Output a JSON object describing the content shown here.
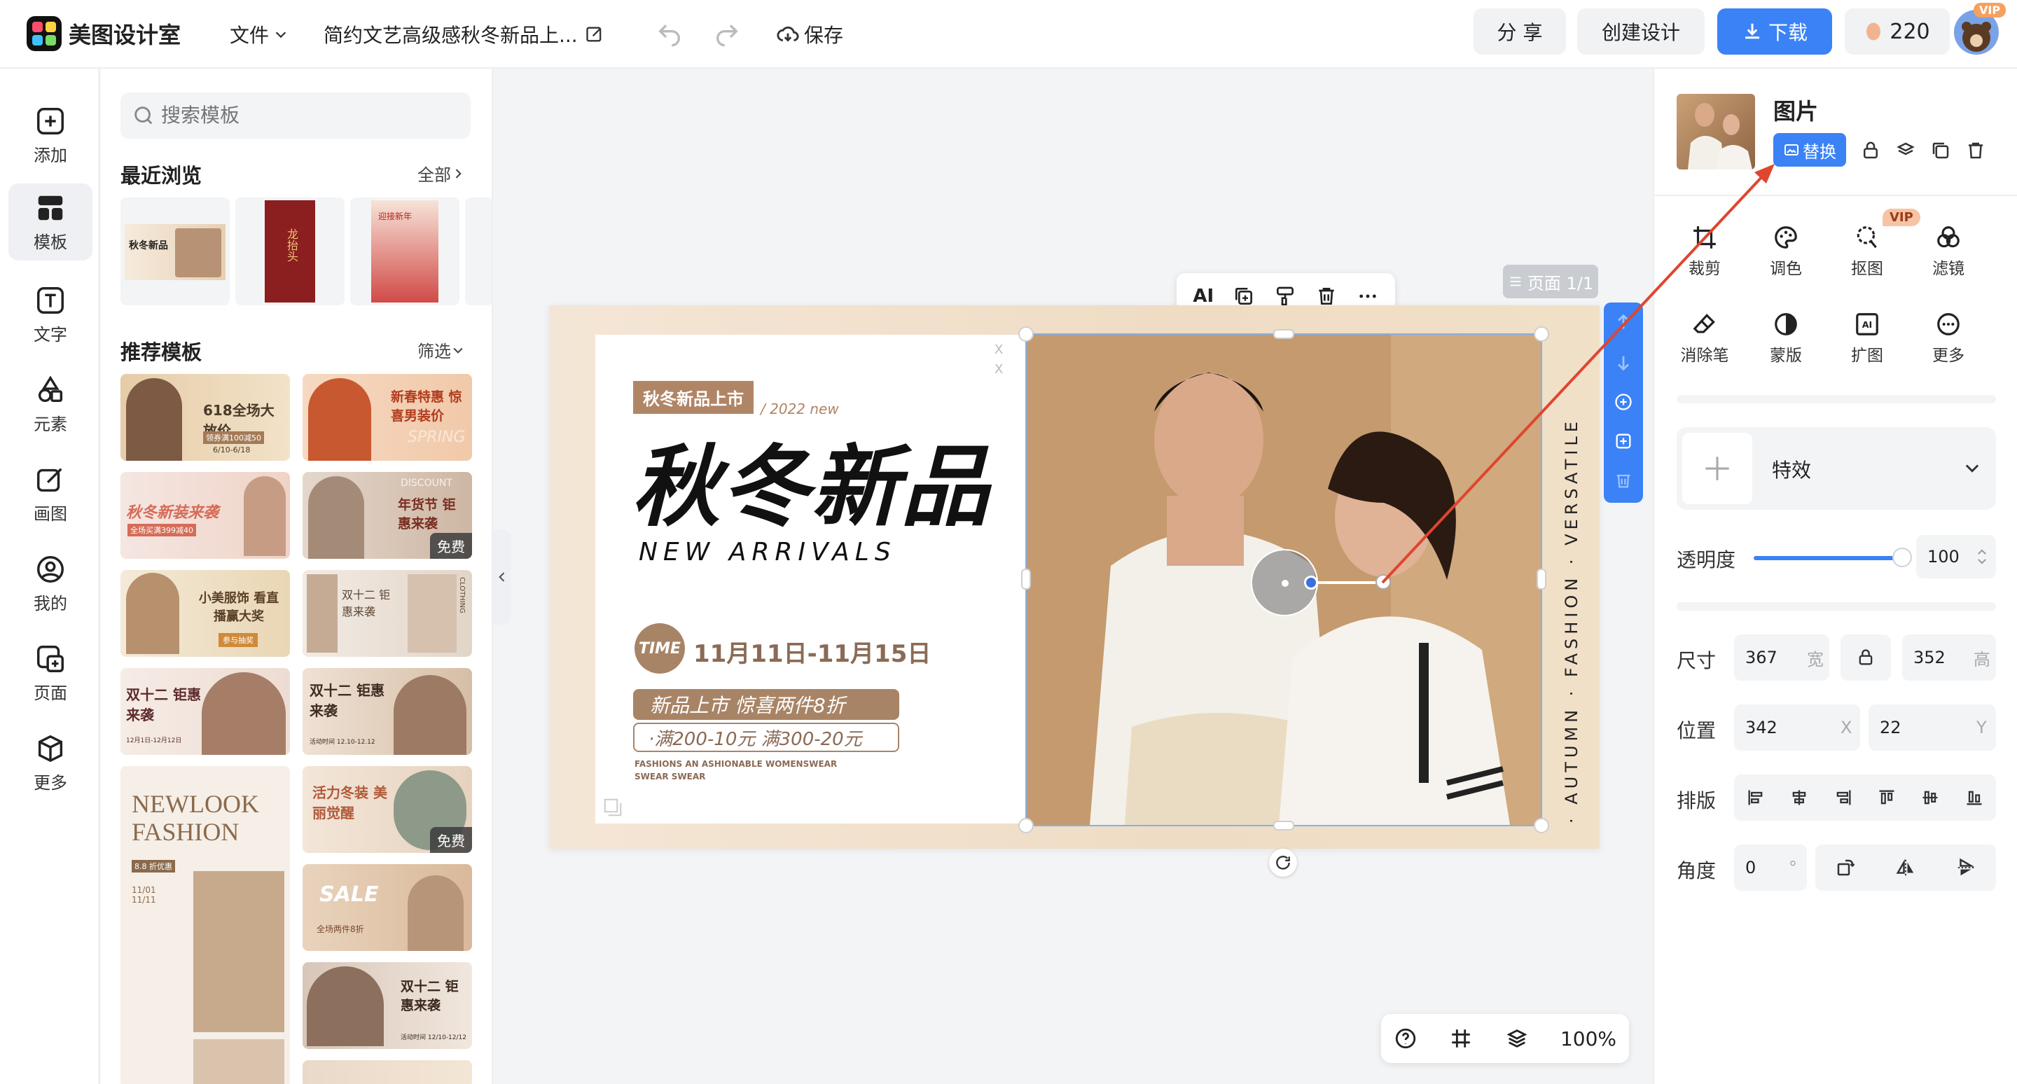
{
  "header": {
    "app_name": "美图设计室",
    "file_menu": "文件",
    "doc_title": "简约文艺高级感秋冬新品上...",
    "save_label": "保存",
    "share_label": "分 享",
    "create_label": "创建设计",
    "download_label": "下载",
    "coins": "220",
    "vip_badge": "VIP"
  },
  "rail": {
    "items": [
      {
        "label": "添加",
        "icon": "plus-square-icon"
      },
      {
        "label": "模板",
        "icon": "template-grid-icon"
      },
      {
        "label": "文字",
        "icon": "text-t-icon"
      },
      {
        "label": "元素",
        "icon": "shapes-icon"
      },
      {
        "label": "画图",
        "icon": "pencil-icon"
      },
      {
        "label": "我的",
        "icon": "user-icon"
      },
      {
        "label": "页面",
        "icon": "page-add-icon"
      },
      {
        "label": "更多",
        "icon": "box-icon"
      }
    ]
  },
  "panel": {
    "search_placeholder": "搜索模板",
    "recent_title": "最近浏览",
    "recent_all": "全部",
    "recommended_title": "推荐模板",
    "filter_label": "筛选",
    "recent_cards": [
      {
        "title": "秋冬新品"
      },
      {
        "title": "龙抬头"
      },
      {
        "title": "迎接新年"
      }
    ],
    "templates": [
      {
        "title": "618全场大放价",
        "sub": "领券满100减50",
        "date": "6/10-6/18"
      },
      {
        "title": "新春特惠 惊喜男装价",
        "sub": "SPRING"
      },
      {
        "title": "秋冬新装来袭",
        "sub": "全场买满399减40"
      },
      {
        "title": "年货节 钜惠来袭",
        "sub": "DISCOUNT",
        "badge": "免费"
      },
      {
        "title": "小美服饰 看直播赢大奖",
        "sub": "参与抽奖"
      },
      {
        "title": "双十二 钜惠来袭",
        "sub": "CLOTHING"
      },
      {
        "title": "双十二 钜惠来袭",
        "sub": "12月1日-12月12日"
      },
      {
        "title": "双十二 钜惠来袭",
        "sub": "活动时间 12.10-12.12"
      },
      {
        "title": "NEWLOOK FASHION",
        "sub": "8.8 折优惠",
        "date": "11/01 11/11"
      },
      {
        "title": "活力冬装 美丽觉醒",
        "badge": "免费"
      },
      {
        "title": "SALE",
        "sub": "全场两件8折"
      },
      {
        "title": "双十二 钜惠来袭",
        "sub": "活动时间 12/10-12/12"
      }
    ]
  },
  "canvas": {
    "page_indicator": "页面 1/1",
    "toolbar_ai": "AI",
    "zoom": "100%",
    "design": {
      "tag": "秋冬新品上市",
      "year": "/ 2022 new",
      "headline": "秋冬新品",
      "subline": "NEW ARRIVALS",
      "time_badge": "TIME",
      "date_range": "11月11日-11月15日",
      "promo1": "新品上市   惊喜两件8折",
      "promo2": "·满200-10元   满300-20元",
      "fine1": "FASHIONS AN   ASHIONABLE WOMENSWEAR",
      "fine2": "SWEAR SWEAR",
      "vertical": "· AUTUMN   · FASHION   · VERSATILE",
      "x_marks": "X X"
    }
  },
  "right": {
    "title": "图片",
    "replace_label": "替换",
    "tools": [
      {
        "label": "裁剪",
        "icon": "crop-icon"
      },
      {
        "label": "调色",
        "icon": "palette-icon"
      },
      {
        "label": "抠图",
        "icon": "cutout-icon",
        "badge": "VIP"
      },
      {
        "label": "滤镜",
        "icon": "filter-icon"
      },
      {
        "label": "消除笔",
        "icon": "eraser-icon"
      },
      {
        "label": "蒙版",
        "icon": "mask-icon"
      },
      {
        "label": "扩图",
        "icon": "expand-ai-icon"
      },
      {
        "label": "更多",
        "icon": "more-icon"
      }
    ],
    "effect_label": "特效",
    "opacity_label": "透明度",
    "opacity_value": "100",
    "opacity_level": 1.0,
    "size_label": "尺寸",
    "width_value": "367",
    "width_unit": "宽",
    "height_value": "352",
    "height_unit": "高",
    "position_label": "位置",
    "x_value": "342",
    "x_unit": "X",
    "y_value": "22",
    "y_unit": "Y",
    "arrange_label": "排版",
    "angle_label": "角度",
    "angle_value": "0",
    "angle_unit": "°"
  },
  "colors": {
    "primary": "#3b82f6",
    "accent_brown": "#b08566",
    "vip": "#f5b08a",
    "annotation_red": "#e0452f"
  }
}
